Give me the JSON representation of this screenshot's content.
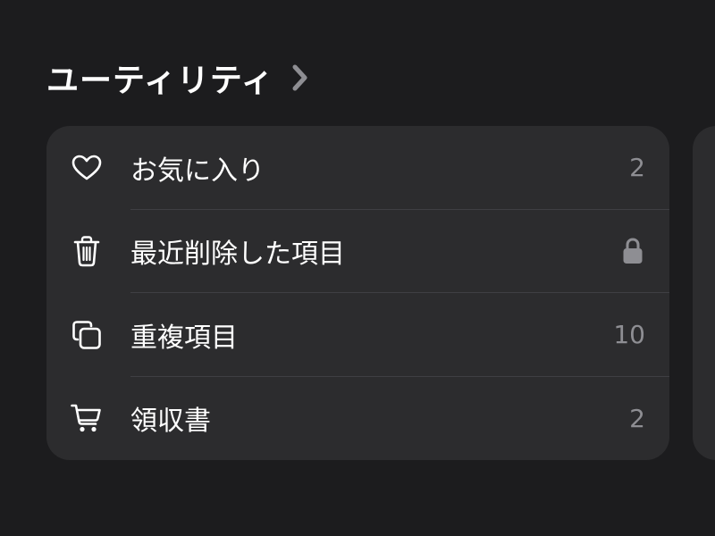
{
  "section": {
    "title": "ユーティリティ",
    "chevron_icon": "chevron-right-icon"
  },
  "items": [
    {
      "icon": "heart-icon",
      "label": "お気に入り",
      "value": "2"
    },
    {
      "icon": "trash-icon",
      "label": "最近削除した項目",
      "value_icon": "lock-icon"
    },
    {
      "icon": "duplicate-icon",
      "label": "重複項目",
      "value": "10"
    },
    {
      "icon": "cart-icon",
      "label": "領収書",
      "value": "2"
    }
  ],
  "colors": {
    "background": "#1c1c1e",
    "card": "#2c2c2e",
    "text": "#ffffff",
    "secondary": "#8e8e93",
    "divider": "#3f3f43"
  }
}
